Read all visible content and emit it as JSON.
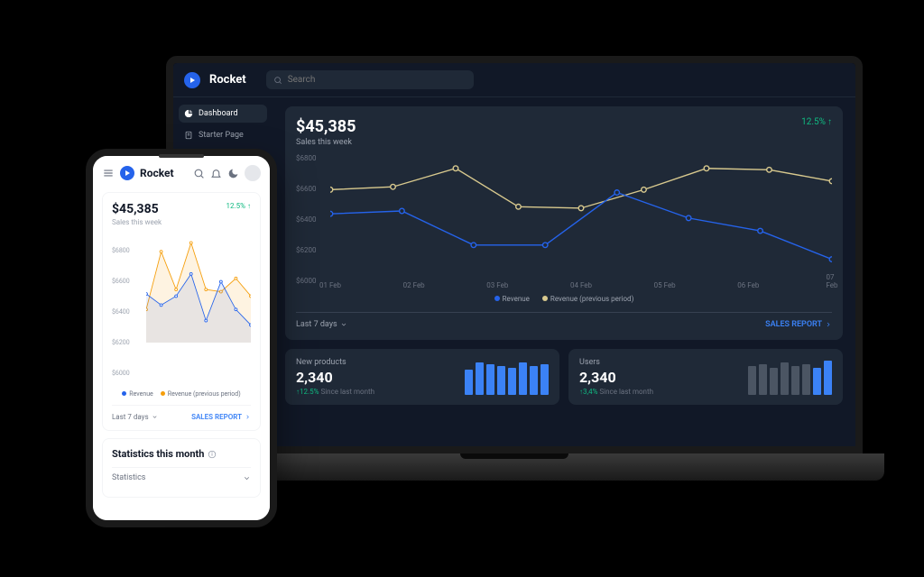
{
  "brand": "Rocket",
  "search": {
    "placeholder": "Search"
  },
  "sidebar": {
    "items": [
      {
        "label": "Dashboard",
        "icon": "pie-icon",
        "active": true
      },
      {
        "label": "Starter Page",
        "icon": "doc-icon",
        "active": false
      }
    ]
  },
  "sales": {
    "amount": "$45,385",
    "subtitle": "Sales this week",
    "growth": "12.5%",
    "range": "Last 7 days",
    "report_link": "SALES REPORT"
  },
  "legend": {
    "revenue": "Revenue",
    "previous": "Revenue (previous period)"
  },
  "stats": {
    "products": {
      "label": "New products",
      "value": "2,340",
      "delta": "12.5%",
      "since": "Since last month"
    },
    "users": {
      "label": "Users",
      "value": "2,340",
      "delta": "3,4%",
      "since": "Since last month"
    }
  },
  "mobile": {
    "stats_title": "Statistics this month",
    "stats_select": "Statistics"
  },
  "colors": {
    "revenue": "#2563eb",
    "previous_desktop": "#d8c98e",
    "previous_mobile": "#f59e0b",
    "green": "#10b981"
  },
  "chart_data": {
    "type": "line",
    "x": [
      "01 Feb",
      "02 Feb",
      "03 Feb",
      "04 Feb",
      "05 Feb",
      "06 Feb",
      "07 Feb"
    ],
    "yticks": [
      6000,
      6200,
      6400,
      6600,
      6800
    ],
    "ylim": [
      6000,
      6800
    ],
    "series": [
      {
        "name": "Revenue",
        "values": [
          6380,
          6400,
          6160,
          6160,
          6530,
          6350,
          6260,
          6060
        ]
      },
      {
        "name": "Revenue (previous period)",
        "values": [
          6550,
          6570,
          6700,
          6430,
          6420,
          6550,
          6700,
          6690,
          6610
        ]
      }
    ],
    "mini_products": [
      28,
      36,
      34,
      32,
      30,
      36,
      32,
      34
    ],
    "mini_users": [
      32,
      34,
      30,
      36,
      32,
      34,
      30,
      38
    ]
  },
  "mobile_chart_data": {
    "type": "line",
    "yticks": [
      6000,
      6200,
      6400,
      6600,
      6800
    ],
    "ylim": [
      5900,
      6900
    ],
    "series": [
      {
        "name": "Revenue",
        "values": [
          6340,
          6240,
          6320,
          6520,
          6100,
          6450,
          6200,
          6060
        ]
      },
      {
        "name": "Revenue (previous period)",
        "values": [
          6200,
          6720,
          6380,
          6800,
          6380,
          6360,
          6480,
          6320
        ]
      }
    ]
  }
}
